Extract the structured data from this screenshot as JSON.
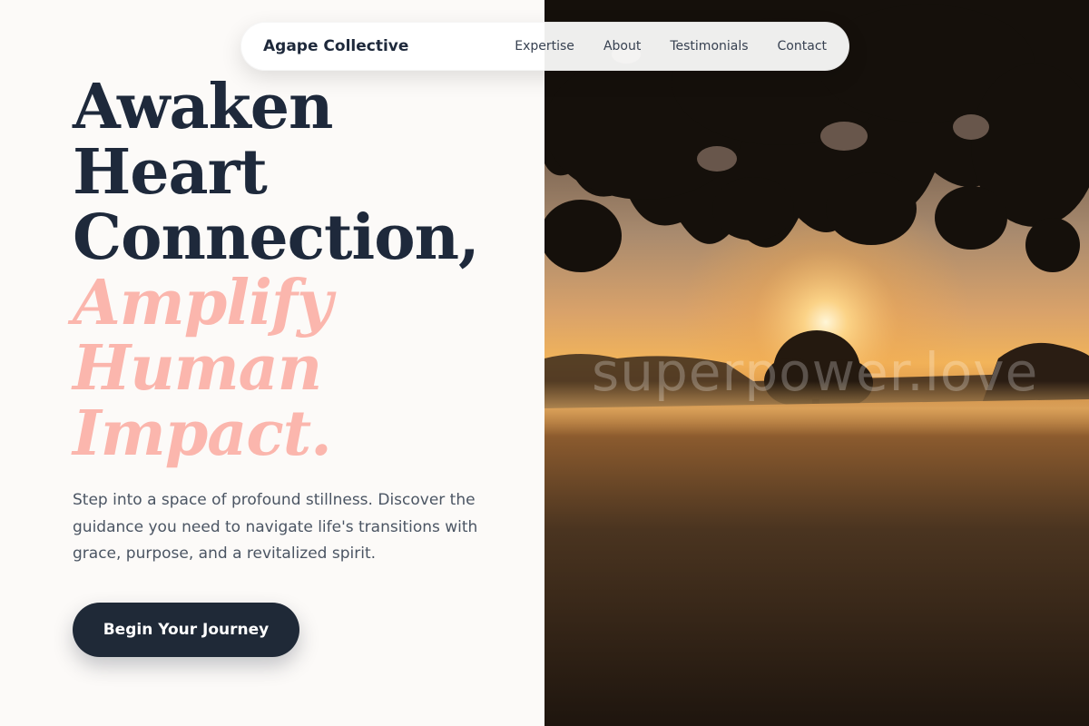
{
  "nav": {
    "brand": "Agape Collective",
    "links": [
      "Expertise",
      "About",
      "Testimonials",
      "Contact"
    ]
  },
  "hero": {
    "headline_lines": [
      "Awaken",
      "Heart",
      "Connection,"
    ],
    "accent_lines": [
      "Amplify",
      "Human",
      "Impact."
    ],
    "subtitle": "Step into a space of profound stillness. Discover the guidance you need to navigate life's transitions with grace, purpose, and a revitalized spirit.",
    "cta_label": "Begin Your Journey"
  },
  "image": {
    "watermark": "superpower.love",
    "description_icon": "sunrise-tree-field-photo"
  },
  "colors": {
    "primary_dark": "#1e293b",
    "accent_pink": "#fbb6ad",
    "background": "#fcfaf8",
    "button": "#1f2937"
  }
}
